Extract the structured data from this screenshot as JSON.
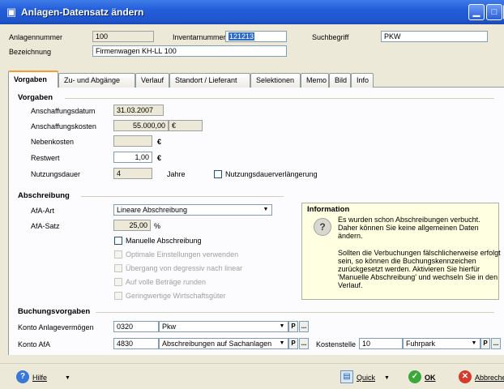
{
  "window": {
    "title": "Anlagen-Datensatz ändern"
  },
  "header": {
    "anlagennummer_label": "Anlagennummer",
    "anlagennummer_value": "100",
    "inventarnummer_label": "Inventarnummer",
    "inventarnummer_value": "121213",
    "suchbegriff_label": "Suchbegriff",
    "suchbegriff_value": "PKW",
    "bezeichnung_label": "Bezeichnung",
    "bezeichnung_value": "Firmenwagen KH-LL 100"
  },
  "tabs": [
    {
      "label": "Vorgaben"
    },
    {
      "label": "Zu- und Abgänge"
    },
    {
      "label": "Verlauf"
    },
    {
      "label": "Standort / Lieferant"
    },
    {
      "label": "Selektionen"
    },
    {
      "label": "Memo"
    },
    {
      "label": "Bild"
    },
    {
      "label": "Info"
    }
  ],
  "vorgaben": {
    "section": "Vorgaben",
    "anschaffungsdatum_label": "Anschaffungsdatum",
    "anschaffungsdatum_value": "31.03.2007",
    "anschaffungskosten_label": "Anschaffungskosten",
    "anschaffungskosten_value": "55.000,00",
    "nebenkosten_label": "Nebenkosten",
    "nebenkosten_value": "",
    "restwert_label": "Restwert",
    "restwert_value": "1,00",
    "currency": "€",
    "nutzungsdauer_label": "Nutzungsdauer",
    "nutzungsdauer_value": "4",
    "jahre_label": "Jahre",
    "verlaengerung_label": "Nutzungsdauerverlängerung"
  },
  "abschreibung": {
    "section": "Abschreibung",
    "afa_art_label": "AfA-Art",
    "afa_art_value": "Lineare Abschreibung",
    "afa_satz_label": "AfA-Satz",
    "afa_satz_value": "25,00",
    "percent": "%",
    "options": [
      {
        "label": "Manuelle Abschreibung",
        "disabled": false
      },
      {
        "label": "Optimale Einstellungen verwenden",
        "disabled": true
      },
      {
        "label": "Übergang von degressiv nach linear",
        "disabled": true
      },
      {
        "label": "Auf volle Beträge runden",
        "disabled": true
      },
      {
        "label": "Geringwertige Wirtschaftsgüter",
        "disabled": true
      }
    ]
  },
  "information": {
    "title": "Information",
    "line1": "Es wurden schon Abschreibungen verbucht.",
    "line2": "Daher können Sie keine allgemeinen Daten",
    "line3": "ändern.",
    "line4": "Sollten die Verbuchungen fälschlicherweise erfolgt",
    "line5": "sein, so können die Buchungskennzeichen",
    "line6": "zurückgesetzt werden. Aktivieren Sie hierfür",
    "line7": "'Manuelle Abschreibung' und wechseln Sie in den",
    "line8": "Verlauf."
  },
  "buchung": {
    "section": "Buchungsvorgaben",
    "konto_anlage_label": "Konto Anlagevermögen",
    "konto_anlage_nr": "0320",
    "konto_anlage_name": "Pkw",
    "konto_afa_label": "Konto AfA",
    "konto_afa_nr": "4830",
    "konto_afa_name": "Abschreibungen auf Sachanlagen",
    "kostenstelle_label": "Kostenstelle",
    "kostenstelle_nr": "10",
    "kostenstelle_name": "Fuhrpark",
    "p_label": "P",
    "ellipsis": "..."
  },
  "footer": {
    "hilfe": "Hilfe",
    "quick": "Quick",
    "ok": "OK",
    "abbrechen": "Abbrechen"
  }
}
